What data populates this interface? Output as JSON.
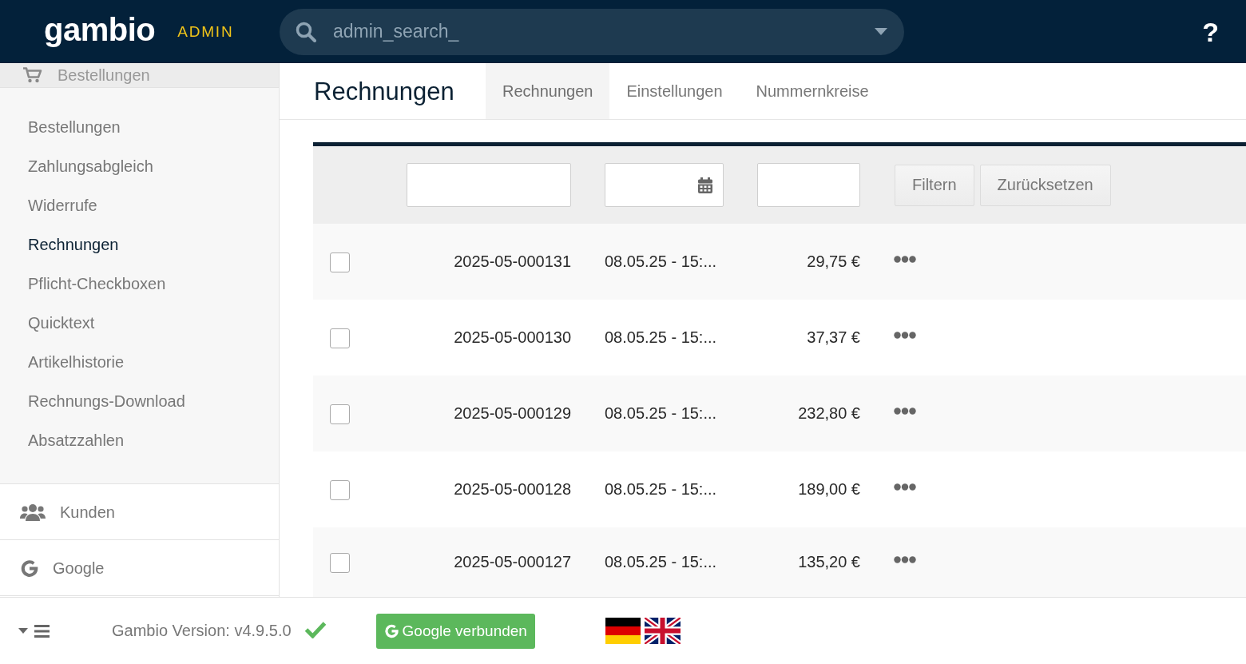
{
  "header": {
    "logo": "gambio",
    "badge": "ADMIN",
    "search": {
      "placeholder": "admin_search_"
    },
    "help": "?"
  },
  "sidebar": {
    "sections": [
      {
        "label": "Bestellungen",
        "kind": "cart",
        "expanded": true,
        "items": [
          {
            "label": "Bestellungen",
            "selected": false
          },
          {
            "label": "Zahlungsabgleich",
            "selected": false
          },
          {
            "label": "Widerrufe",
            "selected": false
          },
          {
            "label": "Rechnungen",
            "selected": true
          },
          {
            "label": "Pflicht-Checkboxen",
            "selected": false
          },
          {
            "label": "Quicktext",
            "selected": false
          },
          {
            "label": "Artikelhistorie",
            "selected": false
          },
          {
            "label": "Rechnungs-Download",
            "selected": false
          },
          {
            "label": "Absatzzahlen",
            "selected": false
          }
        ]
      },
      {
        "label": "Kunden",
        "kind": "users",
        "expanded": false
      },
      {
        "label": "Google",
        "kind": "google",
        "expanded": false
      }
    ]
  },
  "page": {
    "title": "Rechnungen",
    "tabs": [
      {
        "label": "Rechnungen",
        "selected": true
      },
      {
        "label": "Einstellungen",
        "selected": false
      },
      {
        "label": "Nummernkreise",
        "selected": false
      }
    ]
  },
  "table": {
    "filter": {
      "buttons": [
        "Filtern",
        "Zurücksetzen"
      ]
    },
    "rows": [
      {
        "number": "2025-05-000131",
        "date": "08.05.25 - 15:...",
        "amount": "29,75 €",
        "checked": false
      },
      {
        "number": "2025-05-000130",
        "date": "08.05.25 - 15:...",
        "amount": "37,37 €",
        "checked": false
      },
      {
        "number": "2025-05-000129",
        "date": "08.05.25 - 15:...",
        "amount": "232,80 €",
        "checked": false
      },
      {
        "number": "2025-05-000128",
        "date": "08.05.25 - 15:...",
        "amount": "189,00 €",
        "checked": false
      },
      {
        "number": "2025-05-000127",
        "date": "08.05.25 - 15:...",
        "amount": "135,20 €",
        "checked": false
      }
    ]
  },
  "footer": {
    "version": "Gambio Version: v4.9.5.0",
    "google_button": "Google verbunden"
  }
}
